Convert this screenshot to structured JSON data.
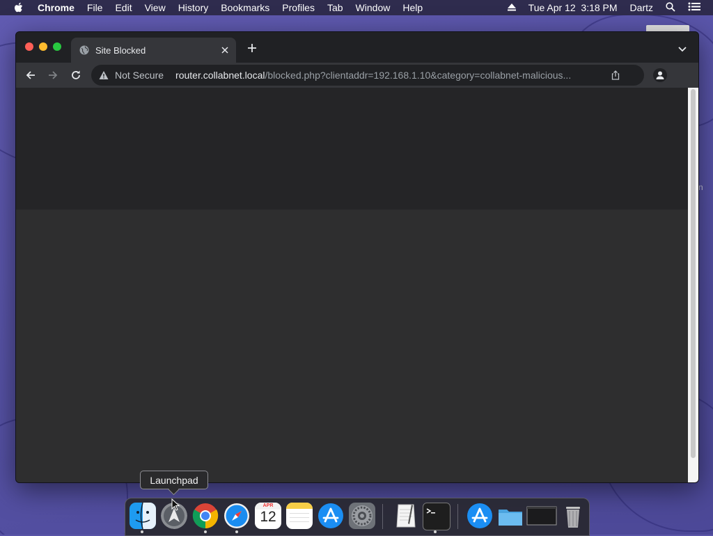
{
  "menubar": {
    "app_name": "Chrome",
    "items": [
      "File",
      "Edit",
      "View",
      "History",
      "Bookmarks",
      "Profiles",
      "Tab",
      "Window",
      "Help"
    ],
    "datetime": "Tue Apr 12  3:18 PM",
    "user": "Dartz"
  },
  "desktop": {
    "label_fragment": "n"
  },
  "browser": {
    "tab_title": "Site Blocked",
    "security_label": "Not Secure",
    "url_host": "router.collabnet.local",
    "url_path": "/blocked.php?clientaddr=192.168.1.10&category=collabnet-malicious..."
  },
  "tooltip": {
    "text": "Launchpad"
  },
  "dock": {
    "calendar_month": "APR",
    "calendar_day": "12",
    "items": [
      "finder",
      "launchpad",
      "chrome",
      "safari",
      "calendar",
      "notes",
      "app-store",
      "system-preferences",
      "textedit",
      "terminal",
      "app-store-downloads",
      "documents-folder",
      "screenshot-window",
      "trash"
    ]
  },
  "colors": {
    "menubar": "#2f2c4e",
    "wallpaper": "#5a55a8",
    "chrome_frame": "#202124",
    "chrome_toolbar": "#35363a",
    "content": "#2e2e2f"
  }
}
